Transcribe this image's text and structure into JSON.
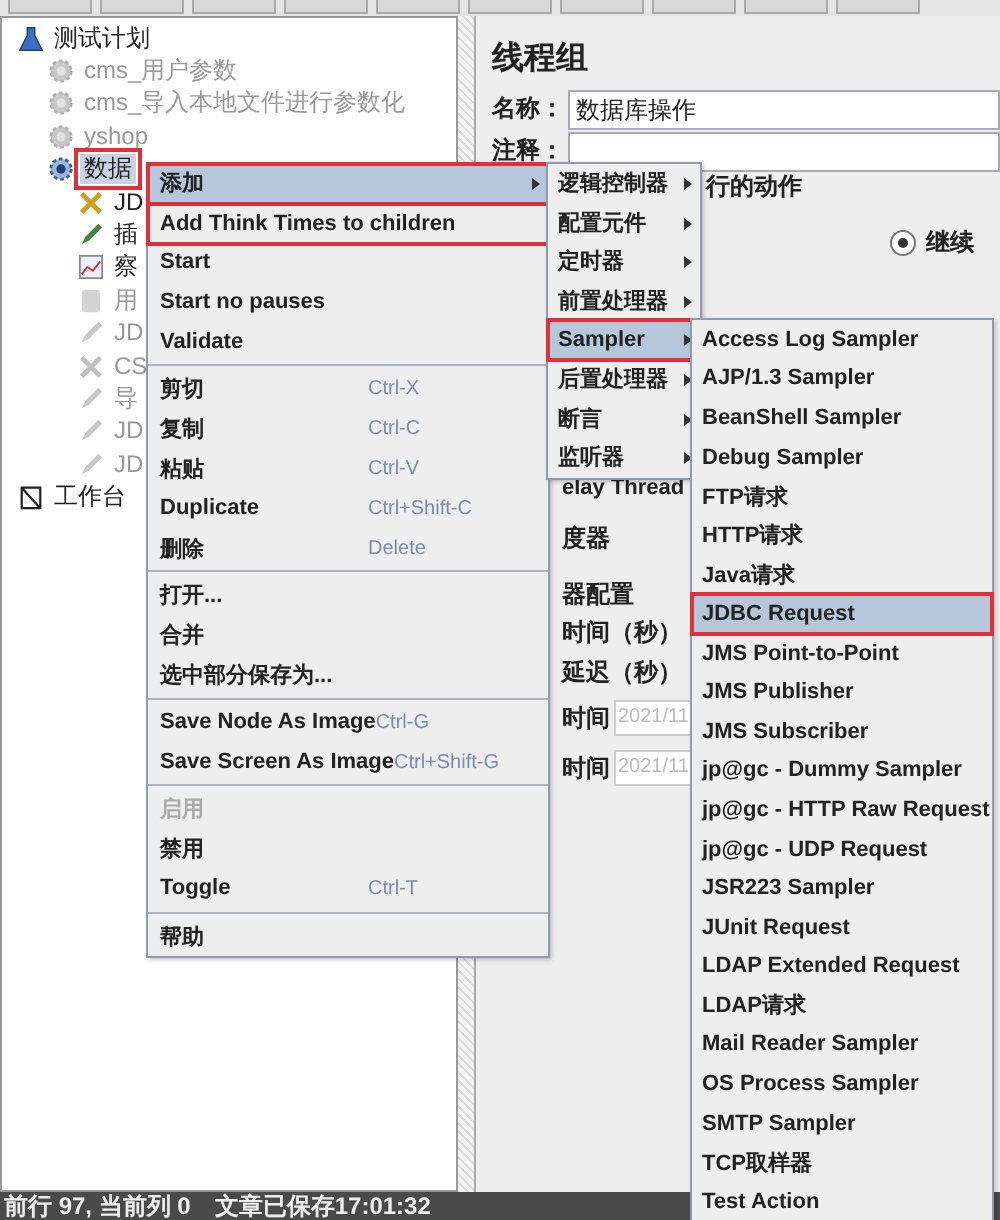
{
  "tree": [
    {
      "label": "测试计划",
      "kind": "plan",
      "selected": false,
      "disabled": false,
      "marked": false,
      "children": [
        {
          "label": "cms_用户参数",
          "kind": "gear",
          "selected": false,
          "disabled": true,
          "marked": false
        },
        {
          "label": "cms_导入本地文件进行参数化",
          "kind": "gear",
          "selected": false,
          "disabled": true,
          "marked": false
        },
        {
          "label": "yshop",
          "kind": "gear",
          "selected": false,
          "disabled": true,
          "marked": false
        },
        {
          "label": "数据",
          "kind": "gear",
          "selected": true,
          "disabled": false,
          "marked": true,
          "children": [
            {
              "label": "JD",
              "kind": "tools",
              "selected": false,
              "disabled": false,
              "marked": false
            },
            {
              "label": "插",
              "kind": "pencil",
              "selected": false,
              "disabled": false,
              "marked": false
            },
            {
              "label": "察",
              "kind": "chart",
              "selected": false,
              "disabled": false,
              "marked": false
            },
            {
              "label": "用",
              "kind": "block",
              "selected": false,
              "disabled": true,
              "marked": false
            },
            {
              "label": "JD",
              "kind": "pencil",
              "selected": false,
              "disabled": true,
              "marked": false
            },
            {
              "label": "CS",
              "kind": "tools",
              "selected": false,
              "disabled": true,
              "marked": false
            },
            {
              "label": "导",
              "kind": "pencil",
              "selected": false,
              "disabled": true,
              "marked": false
            },
            {
              "label": "JD",
              "kind": "pencil",
              "selected": false,
              "disabled": true,
              "marked": false
            },
            {
              "label": "JD",
              "kind": "pencil",
              "selected": false,
              "disabled": true,
              "marked": false
            }
          ]
        }
      ]
    },
    {
      "label": "工作台",
      "kind": "workbench",
      "selected": false,
      "disabled": false,
      "marked": false
    }
  ],
  "panel": {
    "title": "线程组",
    "name_label": "名称：",
    "name_value": "数据库操作",
    "comment_label": "注释：",
    "group_label": "行的动作",
    "radio": {
      "label": "继续",
      "selected": true
    },
    "fragments": [
      "elay Thread",
      "度器",
      "器配置"
    ],
    "fields": [
      {
        "label": "时间（秒）"
      },
      {
        "label": "延迟（秒）"
      },
      {
        "label": "时间",
        "value": "2021/11"
      },
      {
        "label": "时间",
        "value": "2021/11"
      }
    ]
  },
  "context_menu": [
    {
      "kind": "item",
      "label": "添加",
      "submenu": true,
      "selected": true,
      "marked": true,
      "disabled": false
    },
    {
      "kind": "item",
      "label": "Add Think Times to children",
      "selected": false,
      "marked": true,
      "disabled": false
    },
    {
      "kind": "item",
      "label": "Start",
      "selected": false,
      "marked": false,
      "disabled": false
    },
    {
      "kind": "item",
      "label": "Start no pauses",
      "selected": false,
      "marked": false,
      "disabled": false
    },
    {
      "kind": "item",
      "label": "Validate",
      "selected": false,
      "marked": false,
      "disabled": false
    },
    {
      "kind": "separator"
    },
    {
      "kind": "item",
      "label": "剪切",
      "shortcut": "Ctrl-X",
      "selected": false,
      "marked": false,
      "disabled": false
    },
    {
      "kind": "item",
      "label": "复制",
      "shortcut": "Ctrl-C",
      "selected": false,
      "marked": false,
      "disabled": false
    },
    {
      "kind": "item",
      "label": "粘贴",
      "shortcut": "Ctrl-V",
      "selected": false,
      "marked": false,
      "disabled": false
    },
    {
      "kind": "item",
      "label": "Duplicate",
      "shortcut": "Ctrl+Shift-C",
      "selected": false,
      "marked": false,
      "disabled": false
    },
    {
      "kind": "item",
      "label": "删除",
      "shortcut": "Delete",
      "selected": false,
      "marked": false,
      "disabled": false
    },
    {
      "kind": "separator"
    },
    {
      "kind": "item",
      "label": "打开...",
      "selected": false,
      "marked": false,
      "disabled": false
    },
    {
      "kind": "item",
      "label": "合并",
      "selected": false,
      "marked": false,
      "disabled": false
    },
    {
      "kind": "item",
      "label": "选中部分保存为...",
      "selected": false,
      "marked": false,
      "disabled": false
    },
    {
      "kind": "separator"
    },
    {
      "kind": "item",
      "label": "Save Node As Image",
      "shortcut": "Ctrl-G",
      "selected": false,
      "marked": false,
      "disabled": false
    },
    {
      "kind": "item",
      "label": "Save Screen As Image",
      "shortcut": "Ctrl+Shift-G",
      "selected": false,
      "marked": false,
      "disabled": false
    },
    {
      "kind": "separator"
    },
    {
      "kind": "item",
      "label": "启用",
      "selected": false,
      "marked": false,
      "disabled": true
    },
    {
      "kind": "item",
      "label": "禁用",
      "selected": false,
      "marked": false,
      "disabled": false
    },
    {
      "kind": "item",
      "label": "Toggle",
      "shortcut": "Ctrl-T",
      "selected": false,
      "marked": false,
      "disabled": false
    },
    {
      "kind": "separator"
    },
    {
      "kind": "item",
      "label": "帮助",
      "selected": false,
      "marked": false,
      "disabled": false
    }
  ],
  "add_submenu": [
    {
      "label": "逻辑控制器",
      "selected": false,
      "marked": false
    },
    {
      "label": "配置元件",
      "selected": false,
      "marked": false
    },
    {
      "label": "定时器",
      "selected": false,
      "marked": false
    },
    {
      "label": "前置处理器",
      "selected": false,
      "marked": false
    },
    {
      "label": "Sampler",
      "selected": true,
      "marked": true
    },
    {
      "label": "后置处理器",
      "selected": false,
      "marked": false
    },
    {
      "label": "断言",
      "selected": false,
      "marked": false
    },
    {
      "label": "监听器",
      "selected": false,
      "marked": false
    }
  ],
  "sampler_submenu": [
    {
      "label": "Access Log Sampler",
      "selected": false,
      "marked": false
    },
    {
      "label": "AJP/1.3 Sampler",
      "selected": false,
      "marked": false
    },
    {
      "label": "BeanShell Sampler",
      "selected": false,
      "marked": false
    },
    {
      "label": "Debug Sampler",
      "selected": false,
      "marked": false
    },
    {
      "label": "FTP请求",
      "selected": false,
      "marked": false
    },
    {
      "label": "HTTP请求",
      "selected": false,
      "marked": false
    },
    {
      "label": "Java请求",
      "selected": false,
      "marked": false
    },
    {
      "label": "JDBC Request",
      "selected": true,
      "marked": true
    },
    {
      "label": "JMS Point-to-Point",
      "selected": false,
      "marked": false
    },
    {
      "label": "JMS Publisher",
      "selected": false,
      "marked": false
    },
    {
      "label": "JMS Subscriber",
      "selected": false,
      "marked": false
    },
    {
      "label": "jp@gc - Dummy Sampler",
      "selected": false,
      "marked": false
    },
    {
      "label": "jp@gc - HTTP Raw Request",
      "selected": false,
      "marked": false
    },
    {
      "label": "jp@gc - UDP Request",
      "selected": false,
      "marked": false
    },
    {
      "label": "JSR223 Sampler",
      "selected": false,
      "marked": false
    },
    {
      "label": "JUnit Request",
      "selected": false,
      "marked": false
    },
    {
      "label": "LDAP Extended Request",
      "selected": false,
      "marked": false
    },
    {
      "label": "LDAP请求",
      "selected": false,
      "marked": false
    },
    {
      "label": "Mail Reader Sampler",
      "selected": false,
      "marked": false
    },
    {
      "label": "OS Process Sampler",
      "selected": false,
      "marked": false
    },
    {
      "label": "SMTP Sampler",
      "selected": false,
      "marked": false
    },
    {
      "label": "TCP取样器",
      "selected": false,
      "marked": false
    },
    {
      "label": "Test Action",
      "selected": false,
      "marked": false
    }
  ],
  "status_bar": {
    "position": "前行 97, 当前列 0",
    "saved": "文章已保存17:01:32"
  }
}
